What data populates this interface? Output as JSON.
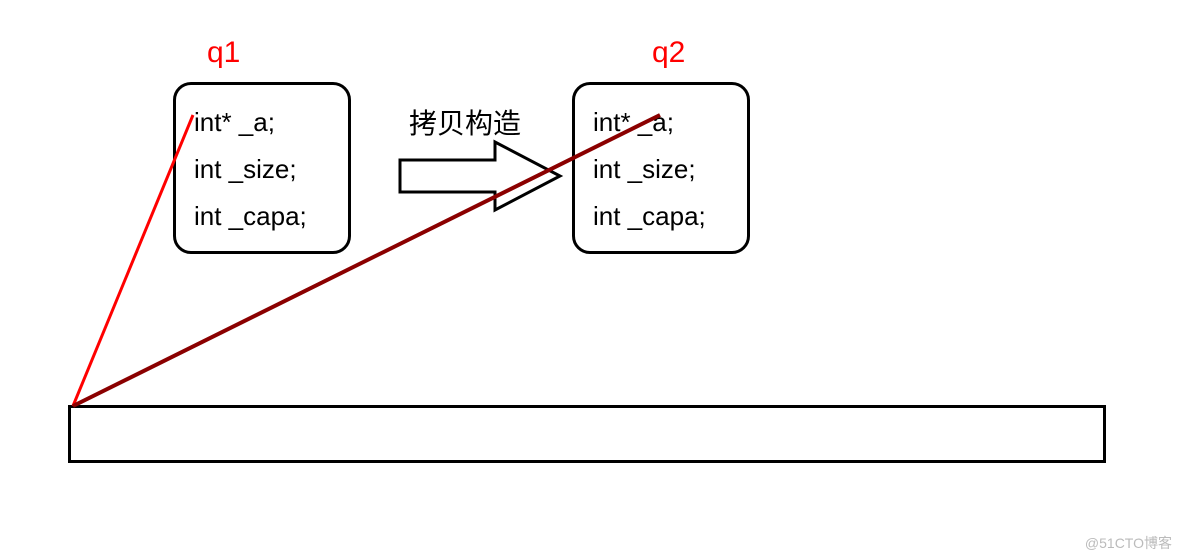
{
  "labels": {
    "q1": "q1",
    "q2": "q2",
    "arrow": "拷贝构造"
  },
  "box1": {
    "line1": "int* _a;",
    "line2": "int _size;",
    "line3": "int _capa;"
  },
  "box2": {
    "line1": "int* _a;",
    "line2": "int _size;",
    "line3": "int _capa;"
  },
  "watermark": "@51CTO博客"
}
